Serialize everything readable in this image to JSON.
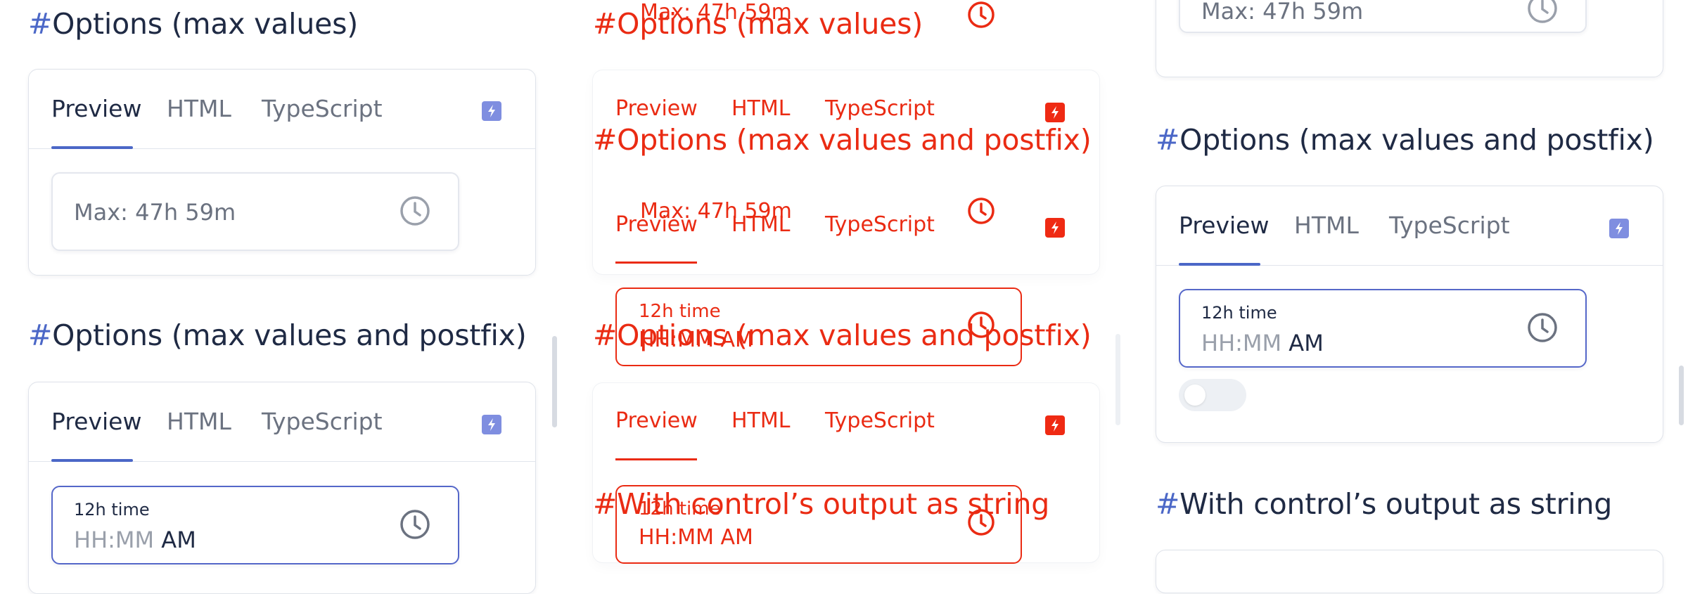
{
  "panel_left": {
    "heading_max": {
      "hash": "#",
      "text": "Options (max values)"
    },
    "card_max": {
      "tabs": [
        "Preview",
        "HTML",
        "TypeScript"
      ],
      "field": {
        "value": "Max: 47h 59m"
      }
    },
    "heading_postfix": {
      "hash": "#",
      "text": "Options (max values and postfix)"
    },
    "card_postfix": {
      "tabs": [
        "Preview",
        "HTML",
        "TypeScript"
      ],
      "field": {
        "label": "12h time",
        "placeholder": "HH:MM",
        "suffix": "AM"
      }
    }
  },
  "panel_middle": {
    "top_text": "Max: 47h 59m",
    "heading_max": {
      "hash": "#",
      "text": "Options (max values)"
    },
    "tabs_a": [
      "Preview",
      "HTML",
      "TypeScript"
    ],
    "heading_postfix_a": {
      "hash": "#",
      "text": "Options (max values and postfix)"
    },
    "field_max_text": "Max: 47h 59m",
    "tabs_b": [
      "Preview",
      "HTML",
      "TypeScript"
    ],
    "field_12h": {
      "label": "12h time",
      "value": "HH:MM AM"
    },
    "heading_postfix_b": {
      "hash": "#",
      "text": "Options (max values and postfix)"
    },
    "tabs_c": [
      "Preview",
      "HTML",
      "TypeScript"
    ],
    "heading_string": {
      "hash": "#",
      "text": "With control’s output as string"
    },
    "field_12h_b": {
      "label": "12h time",
      "value": "HH:MM AM"
    }
  },
  "panel_right": {
    "top_field": {
      "value": "Max: 47h 59m"
    },
    "heading_postfix": {
      "hash": "#",
      "text": "Options (max values and postfix)"
    },
    "card_postfix": {
      "tabs": [
        "Preview",
        "HTML",
        "TypeScript"
      ],
      "field": {
        "label": "12h time",
        "placeholder": "HH:MM",
        "suffix": "AM"
      },
      "toggle": {
        "checked": false
      }
    },
    "heading_string": {
      "hash": "#",
      "text": "With control’s output as string"
    }
  },
  "colors": {
    "accent": "#4b67c7",
    "text": "#1f2a44",
    "muted": "#6b7280",
    "debug_red": "#ea2b13"
  },
  "icons": [
    "clock-icon",
    "lightning-bolt-icon"
  ]
}
